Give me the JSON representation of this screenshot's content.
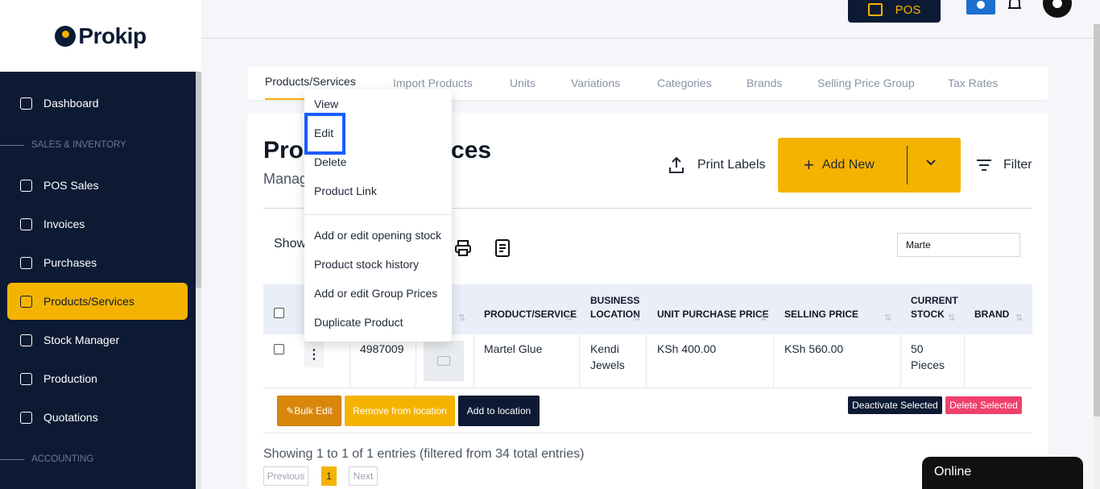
{
  "brand": {
    "name": "Prokip"
  },
  "topbar": {
    "pos_label": "POS"
  },
  "sidebar": {
    "items": [
      {
        "label": "Dashboard",
        "icon": "home-icon"
      },
      {
        "label": "POS Sales",
        "icon": "bag-icon"
      },
      {
        "label": "Invoices",
        "icon": "invoice-icon"
      },
      {
        "label": "Purchases",
        "icon": "box-icon"
      },
      {
        "label": "Products/Services",
        "icon": "cube-icon",
        "active": true
      },
      {
        "label": "Stock Manager",
        "icon": "clipboard-icon"
      },
      {
        "label": "Production",
        "icon": "factory-icon"
      },
      {
        "label": "Quotations",
        "icon": "calculator-icon"
      }
    ],
    "sections": [
      "SALES & INVENTORY",
      "ACCOUNTING"
    ]
  },
  "tabs": [
    "Products/Services",
    "Import Products",
    "Units",
    "Variations",
    "Categories",
    "Brands",
    "Selling Price Group",
    "Tax Rates"
  ],
  "page": {
    "title": "Products/Services",
    "title_visible": "Pro",
    "title_tail": "ces",
    "subtitle_visible": "Manag",
    "print_labels": "Print Labels",
    "add_new": "Add New",
    "filter": "Filter",
    "show_label": "Show"
  },
  "search": {
    "value": "Marte"
  },
  "table": {
    "headers": [
      "PRODUCT/SERVICE",
      "BUSINESS LOCATION",
      "UNIT PURCHASE PRICE",
      "SELLING PRICE",
      "CURRENT STOCK",
      "BRAND"
    ],
    "header_lines": {
      "business": [
        "BUSINESS",
        "LOCATION"
      ],
      "stock": [
        "CURRENT",
        "STOCK"
      ]
    },
    "rows": [
      {
        "sku": "4987009",
        "product": "Martel Glue",
        "location": [
          "Kendi",
          "Jewels"
        ],
        "purchase_price": "KSh 400.00",
        "selling_price": "KSh 560.00",
        "stock": [
          "50",
          "Pieces"
        ],
        "brand": ""
      }
    ]
  },
  "actions": {
    "bulk_edit": "Bulk Edit",
    "remove_from_location": "Remove from location",
    "add_to_location": "Add to location",
    "deactivate_selected": "Deactivate Selected",
    "delete_selected": "Delete Selected"
  },
  "pagination": {
    "summary": "Showing 1 to 1 of 1 entries (filtered from 34 total entries)",
    "previous": "Previous",
    "current_page": "1",
    "next": "Next"
  },
  "menu": {
    "items": [
      "View",
      "Edit",
      "Delete",
      "Product Link",
      "Add or edit opening stock",
      "Product stock history",
      "Add or edit Group Prices",
      "Duplicate Product"
    ],
    "highlighted": "Edit"
  },
  "chat": {
    "status": "Online"
  },
  "colors": {
    "navy": "#0c1a33",
    "accent": "#f5b301",
    "danger": "#f0416b",
    "highlight": "#1a5cff"
  }
}
